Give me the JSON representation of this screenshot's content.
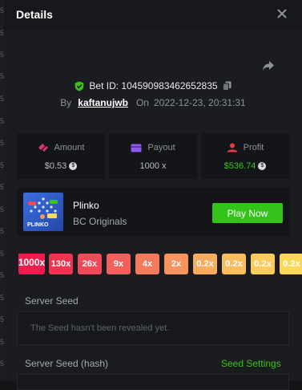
{
  "page_title": "Details",
  "bet": {
    "id_text": "Bet ID: 104590983462652835",
    "by_label": "By",
    "username": "kaftanujwb",
    "on_label": "On",
    "date": "2022-12-23, 20:31:31"
  },
  "stats": {
    "amount": {
      "label": "Amount",
      "value": "$0.53"
    },
    "payout": {
      "label": "Payout",
      "value": "1000 x"
    },
    "profit": {
      "label": "Profit",
      "value": "$536.74"
    }
  },
  "game": {
    "name": "Plinko",
    "provider": "BC Originals",
    "thumb_label": "PLINKO",
    "play_label": "Play Now"
  },
  "multipliers": [
    {
      "label": "1000x",
      "color": "#ee1d4e"
    },
    {
      "label": "130x",
      "color": "#ef3452"
    },
    {
      "label": "26x",
      "color": "#f04958"
    },
    {
      "label": "9x",
      "color": "#f2605c"
    },
    {
      "label": "4x",
      "color": "#f47a5e"
    },
    {
      "label": "2x",
      "color": "#f6935f"
    },
    {
      "label": "0.2x",
      "color": "#f8ac5f"
    },
    {
      "label": "0.2x",
      "color": "#fabd5e"
    },
    {
      "label": "0.2x",
      "color": "#fbcc5b"
    },
    {
      "label": "0.2x",
      "color": "#fcd859"
    }
  ],
  "server_seed": {
    "label": "Server Seed",
    "placeholder": "The Seed hasn't been revealed yet."
  },
  "server_seed_hash": {
    "label": "Server Seed (hash)",
    "settings_link": "Seed Settings"
  },
  "left_strip": [
    "5",
    "5",
    "5",
    "5",
    "5",
    "5",
    "5",
    "5",
    "5",
    "5",
    "5",
    "5",
    "5",
    "5",
    "5",
    "5",
    "5"
  ],
  "colors": {
    "accent_green": "#3bc117",
    "verified_green": "#3bc117",
    "amount_icon": "#e0356a",
    "payout_icon": "#8e5bf0",
    "profit_icon": "#ec3a40",
    "profit_value": "#3bc117"
  },
  "icons": {
    "close": "close-icon",
    "share": "share-icon",
    "verified": "shield-check-icon",
    "copy": "copy-icon",
    "amount": "coins-icon",
    "payout": "wallet-icon",
    "profit": "profit-icon",
    "currency": "currency-coin-icon"
  }
}
